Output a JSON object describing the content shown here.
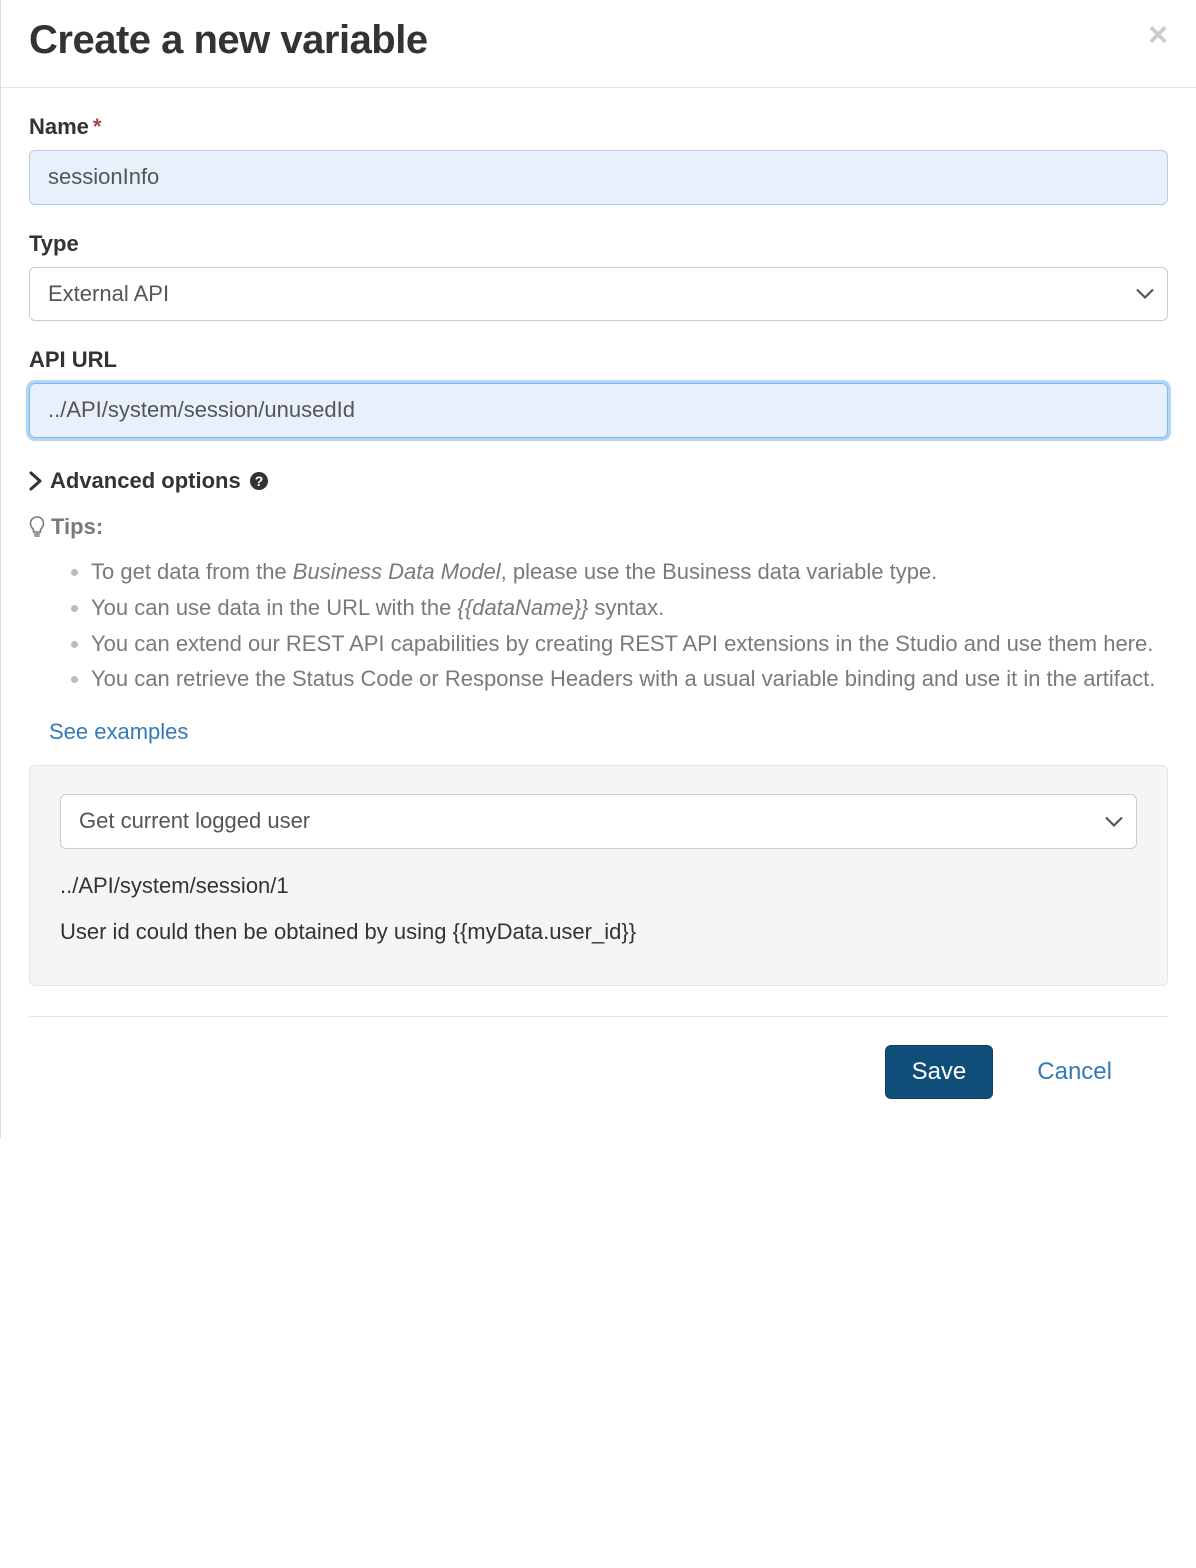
{
  "modal": {
    "title": "Create a new variable"
  },
  "form": {
    "name_label": "Name",
    "name_value": "sessionInfo",
    "type_label": "Type",
    "type_value": "External API",
    "apiurl_label": "API URL",
    "apiurl_value": "../API/system/session/unusedId",
    "advanced_label": "Advanced options"
  },
  "tips": {
    "heading": "Tips:",
    "items": [
      {
        "pre": "To get data from the ",
        "em": "Business Data Model",
        "post": ", please use the Business data variable type."
      },
      {
        "pre": "You can use data in the URL with the ",
        "em": "{{dataName}}",
        "post": " syntax."
      },
      {
        "text": "You can extend our REST API capabilities by creating REST API extensions in the Studio and use them here."
      },
      {
        "text": "You can retrieve the Status Code or Response Headers with a usual variable binding and use it in the artifact."
      }
    ],
    "see_examples": "See examples"
  },
  "examples": {
    "selected": "Get current logged user",
    "line1": "../API/system/session/1",
    "line2": "User id could then be obtained by using {{myData.user_id}}"
  },
  "footer": {
    "save": "Save",
    "cancel": "Cancel"
  }
}
